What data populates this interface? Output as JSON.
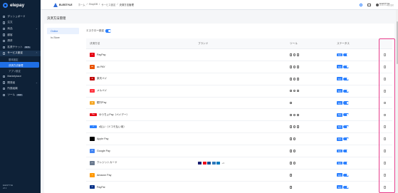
{
  "app": {
    "brand": "elepay"
  },
  "sidebar": {
    "items": [
      {
        "label": "ダッシュボード",
        "icon": "dashboard-icon"
      },
      {
        "label": "注文",
        "icon": "receipt-icon"
      },
      {
        "label": "商品",
        "icon": "box-icon",
        "chevron": "⌄"
      },
      {
        "label": "顧客",
        "icon": "user-icon"
      },
      {
        "label": "請求",
        "icon": "invoice-icon"
      },
      {
        "label": "拡張チケット",
        "icon": "ticket-icon",
        "badge": "BETA"
      }
    ],
    "parent": {
      "label": "サービス設定",
      "icon": "settings-icon",
      "chevron": "⌃"
    },
    "subitems": [
      "基本設定",
      "決済方法管理",
      "アプリ設定"
    ],
    "active_sub": "決済方法管理",
    "after": [
      {
        "label": "Marketplace",
        "icon": "store-icon"
      },
      {
        "label": "開発者",
        "icon": "code-icon",
        "chevron": "⌄"
      },
      {
        "label": "所属組織",
        "icon": "org-icon"
      },
      {
        "label": "ツール",
        "icon": "tool-icon",
        "badge": "NEW"
      }
    ],
    "footer": {
      "line1": "ELESTYLE",
      "line2": "v2.1"
    }
  },
  "topbar": {
    "shop_name": "ELESTYLE",
    "breadcrumb": [
      "ホーム",
      "ShopDB",
      "サービス設定",
      "決済方法管理"
    ]
  },
  "user": {
    "name": "ELESTYLE",
    "sub": "ELESTYLE株式会社"
  },
  "page": {
    "title": "決済方法管理"
  },
  "subnav": [
    "Online",
    "In-Store"
  ],
  "active_subnav": "Online",
  "test_toggle": {
    "label": "エスクロー設定",
    "on": true
  },
  "table": {
    "headers": {
      "name": "決済方法",
      "brand": "ブランド",
      "tools": "ツール",
      "status": "ステータス"
    },
    "rows": [
      {
        "name": "PayPay",
        "logo_color": "#e60012",
        "logo_text": "P",
        "tools": 3,
        "status": "有効"
      },
      {
        "name": "au PAY",
        "logo_color": "#ea5404",
        "logo_text": "au",
        "tools": 3,
        "status": "有効"
      },
      {
        "name": "楽天ペイ",
        "logo_color": "#bf0000",
        "logo_text": "R",
        "tools": 3,
        "status": "有効"
      },
      {
        "name": "メルペイ",
        "logo_color": "#ff333f",
        "logo_text": "m",
        "tools": 3,
        "status": "有効"
      },
      {
        "name": "銀行Pay",
        "logo_color": "#f5a623",
        "logo_text": "B",
        "tools": 1,
        "status": "有効"
      },
      {
        "name": "ゆうちょPay（ペイデー）",
        "logo_color": "#e60012",
        "logo_text": "Pay",
        "wide": true,
        "tools": 3,
        "status": "有効"
      },
      {
        "name": "d払い（ドコモ払い用）",
        "logo_color": "#2b80ff",
        "logo_text": "d",
        "wide": true,
        "tools": 3,
        "status": "有効"
      },
      {
        "name": "Apple Pay",
        "logo_color": "#000000",
        "logo_text": "",
        "tools": 2,
        "status": "有効"
      },
      {
        "name": "Google Pay",
        "logo_color": "#4285f4",
        "logo_text": "G",
        "tools": 2,
        "status": "有効"
      },
      {
        "name": "クレジットカード",
        "logo_color": "#6b7a8f",
        "logo_text": "▭",
        "tools": 2,
        "status": "有効",
        "brands": true
      },
      {
        "name": "Amazon Pay",
        "logo_color": "#ff9900",
        "logo_text": "a",
        "tools": 1,
        "status": "有効"
      },
      {
        "name": "PayPal",
        "logo_color": "#003087",
        "logo_text": "P",
        "tools": 1,
        "status": "有効"
      }
    ],
    "brands": [
      {
        "name": "VISA",
        "color": "#1a1f71"
      },
      {
        "name": "Mastercard",
        "color": "#eb001b"
      },
      {
        "name": "JCB",
        "color": "#0e4c96"
      },
      {
        "name": "AMEX",
        "color": "#2e77bb"
      },
      {
        "name": "Diners",
        "color": "#0079be"
      }
    ],
    "brand_more": "+3"
  },
  "colors": {
    "accent": "#2b80ff",
    "sidebar": "#0e2137",
    "highlight": "#e83a8a"
  }
}
